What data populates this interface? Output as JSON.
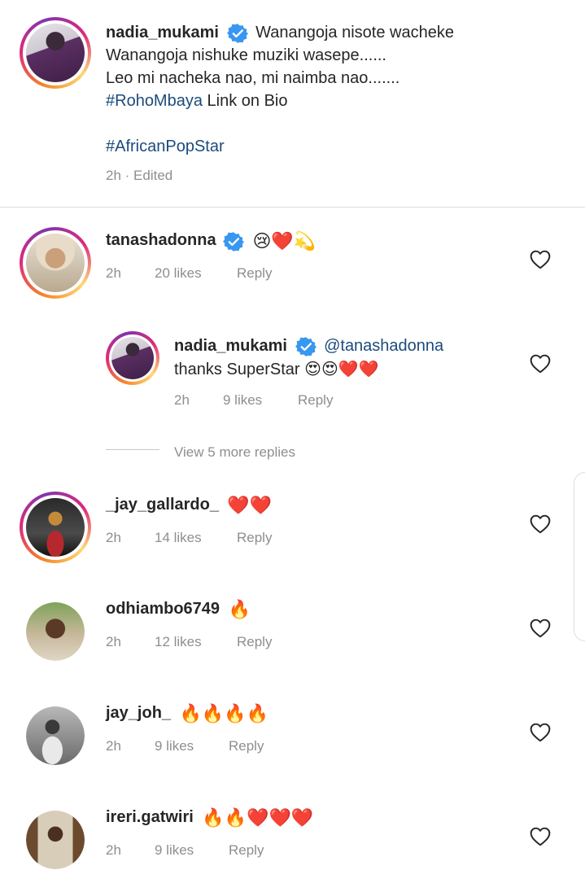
{
  "caption": {
    "username": "nadia_mukami",
    "line1": "Wanangoja nisote wacheke",
    "line2": "Wanangoja nishuke muziki wasepe......",
    "line3": "Leo mi nacheka nao, mi naimba nao.......",
    "hashtag1": "#RohoMbaya",
    "line4_rest": " Link on Bio",
    "hashtag2": "#AfricanPopStar",
    "time": "2h",
    "edited": " · Edited"
  },
  "comments": [
    {
      "username": "tanashadonna",
      "verified": true,
      "text": "😢❤️💫",
      "time": "2h",
      "likes": "20 likes",
      "reply": "Reply"
    },
    {
      "username": "nadia_mukami",
      "verified": true,
      "mention": "@tanashadonna",
      "text": "thanks SuperStar 😍😍❤️❤️",
      "time": "2h",
      "likes": "9 likes",
      "reply": "Reply"
    },
    {
      "username": "_jay_gallardo_",
      "verified": false,
      "text": "❤️❤️",
      "time": "2h",
      "likes": "14 likes",
      "reply": "Reply"
    },
    {
      "username": "odhiambo6749",
      "verified": false,
      "text": "🔥",
      "time": "2h",
      "likes": "12 likes",
      "reply": "Reply"
    },
    {
      "username": "jay_joh_",
      "verified": false,
      "text": "🔥🔥🔥🔥",
      "time": "2h",
      "likes": "9 likes",
      "reply": "Reply"
    },
    {
      "username": "ireri.gatwiri",
      "verified": false,
      "text": "🔥🔥❤️❤️❤️",
      "time": "2h",
      "likes": "9 likes",
      "reply": "Reply"
    }
  ],
  "view_more": "View 5 more replies",
  "colors": {
    "hashtag": "#1c4b7c",
    "verified": "#3897f0",
    "meta": "#8e8e8e",
    "heart_emoji": "#e0245e"
  },
  "icons": {
    "verified": "verified-badge-icon",
    "like": "heart-outline-icon"
  }
}
